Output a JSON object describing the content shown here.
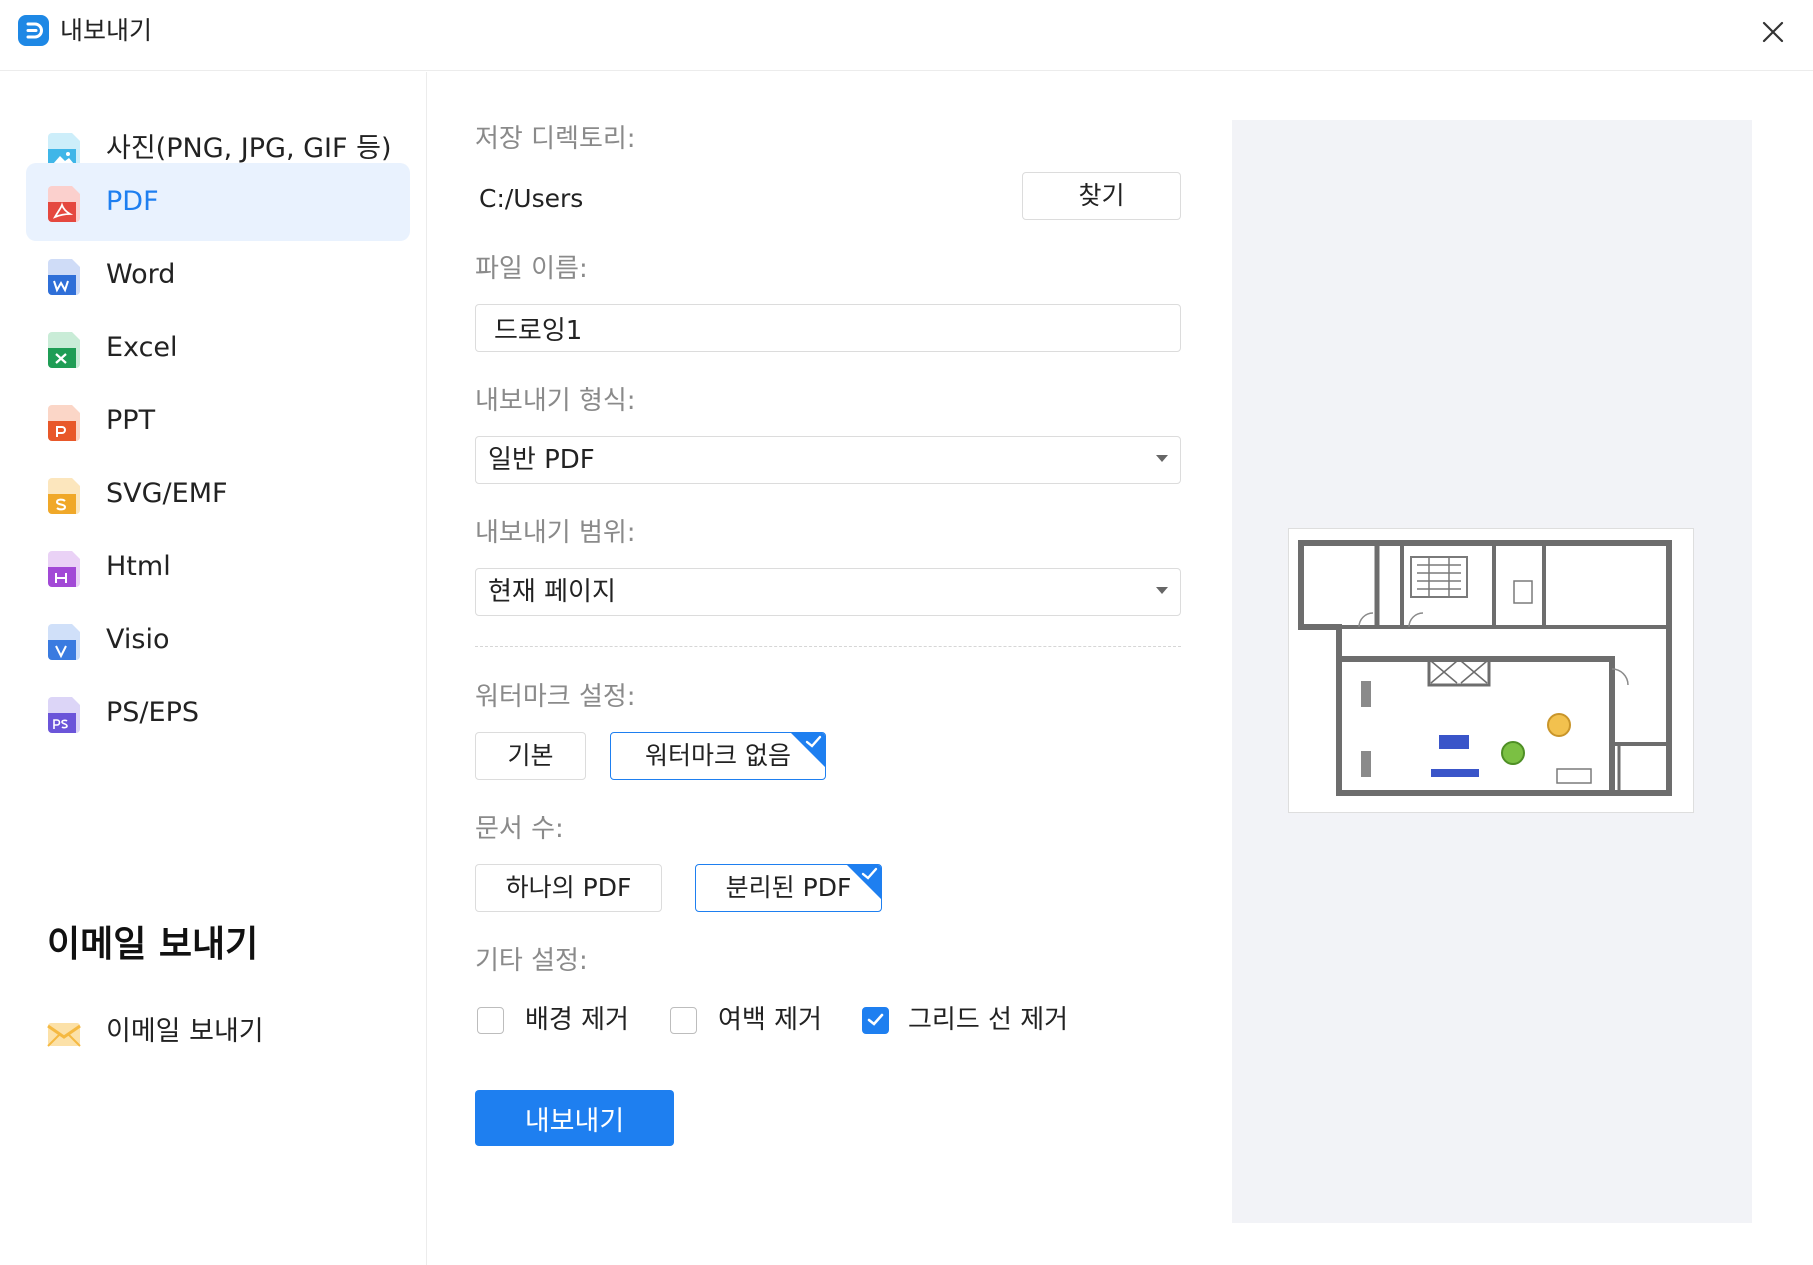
{
  "window": {
    "title": "내보내기",
    "logo_icon": "edraw-logo-icon",
    "close_icon": "close-icon"
  },
  "sidebar": {
    "items": [
      {
        "label": "사진(PNG, JPG, GIF 등)",
        "icon": "image-file-icon",
        "color": "#3fb6e8",
        "selected": false
      },
      {
        "label": "PDF",
        "icon": "pdf-file-icon",
        "color": "#e5483f",
        "selected": true
      },
      {
        "label": "Word",
        "icon": "word-file-icon",
        "color": "#2f6fd8",
        "selected": false
      },
      {
        "label": "Excel",
        "icon": "excel-file-icon",
        "color": "#1f9d55",
        "selected": false
      },
      {
        "label": "PPT",
        "icon": "ppt-file-icon",
        "color": "#e8582a",
        "selected": false
      },
      {
        "label": "SVG/EMF",
        "icon": "svg-file-icon",
        "color": "#f0a829",
        "selected": false
      },
      {
        "label": "Html",
        "icon": "html-file-icon",
        "color": "#a249d6",
        "selected": false
      },
      {
        "label": "Visio",
        "icon": "visio-file-icon",
        "color": "#3a7be0",
        "selected": false
      },
      {
        "label": "PS/EPS",
        "icon": "ps-file-icon",
        "color": "#6b55d9",
        "selected": false
      }
    ],
    "email_heading": "이메일 보내기",
    "email_item": {
      "label": "이메일 보내기",
      "icon": "envelope-icon",
      "color": "#f5b942"
    }
  },
  "form": {
    "directory": {
      "label": "저장 디렉토리:",
      "value": "C:/Users",
      "browse_label": "찾기"
    },
    "filename": {
      "label": "파일 이름:",
      "value": "드로잉1"
    },
    "format": {
      "label": "내보내기 형식:",
      "value": "일반 PDF"
    },
    "range": {
      "label": "내보내기 범위:",
      "value": "현재 페이지"
    },
    "watermark": {
      "label": "워터마크 설정:",
      "options": [
        {
          "label": "기본",
          "selected": false
        },
        {
          "label": "워터마크 없음",
          "selected": true
        }
      ]
    },
    "doc_count": {
      "label": "문서 수:",
      "options": [
        {
          "label": "하나의 PDF",
          "selected": false
        },
        {
          "label": "분리된 PDF",
          "selected": true
        }
      ]
    },
    "other": {
      "label": "기타 설정:",
      "checkboxes": [
        {
          "label": "배경 제거",
          "checked": false
        },
        {
          "label": "여백 제거",
          "checked": false
        },
        {
          "label": "그리드 선 제거",
          "checked": true
        }
      ]
    },
    "export_label": "내보내기"
  },
  "colors": {
    "accent": "#1e7ff0",
    "selected_bg": "#e9f2fe",
    "preview_bg": "#f2f3f7"
  }
}
